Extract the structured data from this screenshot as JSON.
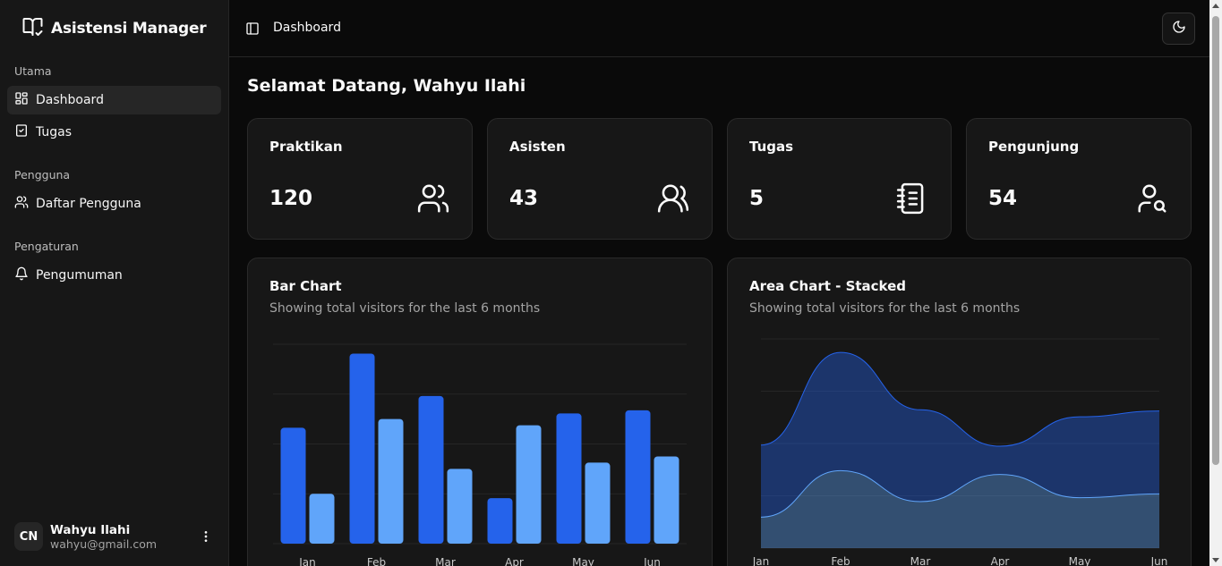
{
  "app": {
    "title": "Asistensi Manager"
  },
  "sidebar": {
    "groups": [
      {
        "label": "Utama",
        "items": [
          {
            "label": "Dashboard",
            "icon": "layout-grid-icon",
            "active": true
          },
          {
            "label": "Tugas",
            "icon": "clipboard-check-icon"
          }
        ]
      },
      {
        "label": "Pengguna",
        "items": [
          {
            "label": "Daftar Pengguna",
            "icon": "users-icon"
          }
        ]
      },
      {
        "label": "Pengaturan",
        "items": [
          {
            "label": "Pengumuman",
            "icon": "bell-icon"
          }
        ]
      }
    ],
    "user": {
      "initials": "CN",
      "name": "Wahyu Ilahi",
      "email": "wahyu@gmail.com"
    }
  },
  "header": {
    "breadcrumb": "Dashboard"
  },
  "main": {
    "greeting": "Selamat Datang, Wahyu Ilahi",
    "stats": [
      {
        "title": "Praktikan",
        "value": "120",
        "icon": "users-icon"
      },
      {
        "title": "Asisten",
        "value": "43",
        "icon": "users-round-icon"
      },
      {
        "title": "Tugas",
        "value": "5",
        "icon": "notebook-icon"
      },
      {
        "title": "Pengunjung",
        "value": "54",
        "icon": "user-search-icon"
      }
    ]
  },
  "chart_data": [
    {
      "type": "bar",
      "title": "Bar Chart",
      "subtitle": "Showing total visitors for the last 6 months",
      "categories": [
        "Jan",
        "Feb",
        "Mar",
        "Apr",
        "May",
        "Jun"
      ],
      "series": [
        {
          "values": [
            186,
            305,
            237,
            73,
            209,
            214
          ],
          "color": "#2563eb"
        },
        {
          "values": [
            80,
            200,
            120,
            190,
            130,
            140
          ],
          "color": "#60a5fa"
        }
      ],
      "ylim": [
        0,
        320
      ],
      "grid": true
    },
    {
      "type": "area",
      "title": "Area Chart - Stacked",
      "subtitle": "Showing total visitors for the last 6 months",
      "categories": [
        "Jan",
        "Feb",
        "Mar",
        "Apr",
        "May",
        "Jun"
      ],
      "series": [
        {
          "values": [
            80,
            200,
            120,
            190,
            130,
            140
          ],
          "color": "#60a5fa"
        },
        {
          "values": [
            186,
            305,
            237,
            73,
            209,
            214
          ],
          "color": "#2563eb"
        }
      ],
      "ylim": [
        0,
        540
      ],
      "stacked": true,
      "grid": true
    }
  ]
}
